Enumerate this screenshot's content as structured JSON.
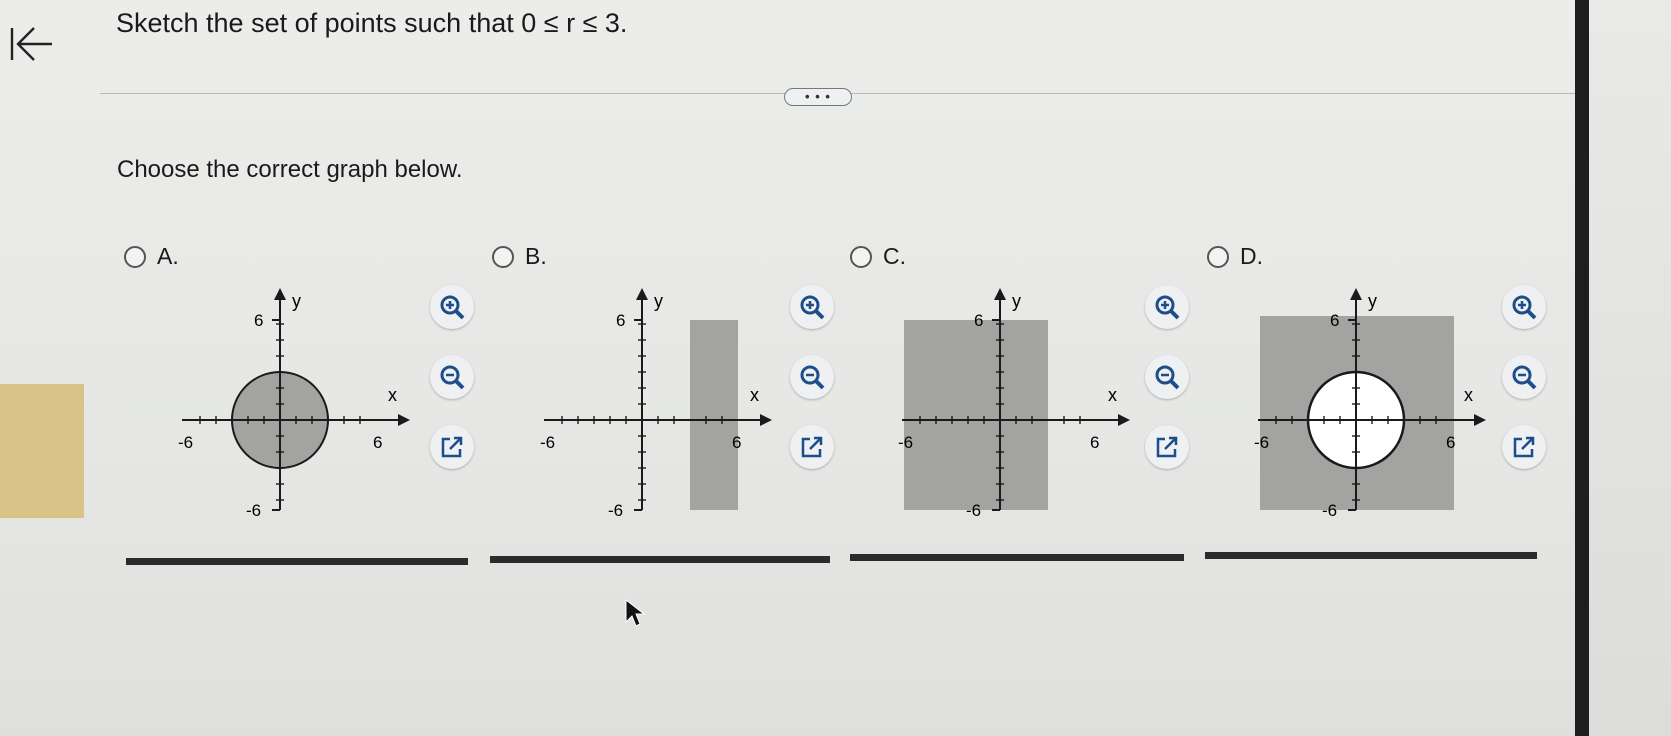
{
  "question": {
    "text": "Sketch the set of points such that 0 ≤ r ≤ 3."
  },
  "more_button": {
    "label": "• • •"
  },
  "prompt": "Choose the correct graph below.",
  "options": [
    {
      "letter": "A.",
      "description": "disk of radius 3 shaded"
    },
    {
      "letter": "B.",
      "description": "vertical strip 3 ≤ x ≤ 6 shaded"
    },
    {
      "letter": "C.",
      "description": "region x ≤ 3 shaded"
    },
    {
      "letter": "D.",
      "description": "square shaded outside circle radius 3"
    }
  ],
  "axes": {
    "x_label": "x",
    "y_label": "y",
    "tick_pos": "6",
    "tick_neg": "-6"
  },
  "tools": {
    "zoom_in": "zoom-in-icon",
    "zoom_out": "zoom-out-icon",
    "open_new": "open-new-window-icon"
  },
  "colors": {
    "shade": "#a3a3a1",
    "axis": "#1a1a1a",
    "tool_icon": "#1e4d8c"
  }
}
